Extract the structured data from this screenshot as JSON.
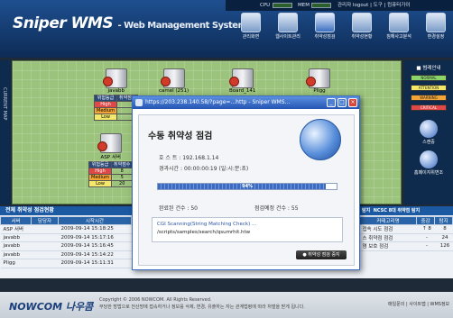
{
  "app": {
    "brand": "Sniper WMS",
    "subtitle": "- Web Management System"
  },
  "topbar": {
    "cpu": "CPU",
    "mem": "MEM",
    "user": "관리자 logout | 도구 | 컴퓨터가이"
  },
  "nav": [
    {
      "label": "관리화면",
      "icon": "monitor-icon"
    },
    {
      "label": "웹사이트관리",
      "icon": "web-icon"
    },
    {
      "label": "취약성점검",
      "icon": "scan-icon"
    },
    {
      "label": "취약성현황",
      "icon": "status-icon"
    },
    {
      "label": "침해사고분석",
      "icon": "incident-icon"
    },
    {
      "label": "환경설정",
      "icon": "settings-icon"
    }
  ],
  "breadcrumb": "관리화면",
  "leftstrip": "CURRENT MAP",
  "map_nodes": [
    {
      "name": "javabb",
      "risk": {
        "header": [
          "위험등급",
          "취약점수"
        ],
        "rows": [
          [
            "High",
            ""
          ],
          [
            "Medium",
            ""
          ],
          [
            "Low",
            ""
          ]
        ]
      }
    },
    {
      "name": "camel (251)"
    },
    {
      "name": "Board_141"
    },
    {
      "name": "Pligg"
    },
    {
      "name": "ASP 서버",
      "risk": {
        "header": [
          "위험등급",
          "취약점수"
        ],
        "rows": [
          [
            "High",
            "8"
          ],
          [
            "Medium",
            "5"
          ],
          [
            "Low",
            "20"
          ]
        ]
      }
    }
  ],
  "legend": {
    "title": "■ 범례안내",
    "items": [
      "NORMAL",
      "ATTENTION",
      "WARNING",
      "CRITICAL"
    ]
  },
  "side": {
    "scan": "스캔중",
    "homepage": "홈페이지위변조"
  },
  "history": {
    "title": "전체 취약성 점검현황",
    "headers": [
      "서버",
      "담당자",
      "시작시간"
    ],
    "rows": [
      [
        "ASP 서버",
        "",
        "2009-09-14 15:18:25"
      ],
      [
        "javabb",
        "",
        "2009-09-14 15:17:16"
      ],
      [
        "javabb",
        "",
        "2009-09-14 15:16:45"
      ],
      [
        "javabb",
        "",
        "2009-09-14 15:14:22"
      ],
      [
        "Pligg",
        "",
        "2009-09-14 15:11:31"
      ]
    ]
  },
  "ncsc": {
    "tabs": [
      "탐지",
      "NCSC 8대 취약점",
      "탐지"
    ],
    "headers": [
      "커테고리명",
      "중감",
      "탐지"
    ],
    "rows": [
      [
        "접속 시도 점검",
        "↑ 8",
        "8"
      ],
      [
        "스 취약점 점검",
        "-",
        "24"
      ],
      [
        "염 보호 점검",
        "-",
        "126"
      ]
    ]
  },
  "footer": {
    "logo": "NOWCOM 나우콤",
    "copy": "Copyright © 2006 NOWCOM. All Rights Reserved.",
    "copy2": "부당한 방법으로 전산망에 접속하거나 정보를 삭제, 변경, 유출하는 자는 관계법령에 따라 처벌을 받게 됩니다.",
    "links": "매일문의 | 사이트맵 | WMS정보"
  },
  "dialog": {
    "window_title": "https://203.238.140.58/?page=...http - Sniper WMS...",
    "title": "수동 취약성 점검",
    "host_label": "호 스 트 :",
    "host": "192.168.1.14",
    "elapsed_label": "경과시간 :",
    "elapsed": "00:00:00:19 (일:시:분:초)",
    "progress_text": "94%",
    "progress": 0.94,
    "done_label": "완료된 건수 :",
    "done": "50",
    "planned_label": "점검예정 건수 :",
    "planned": "55",
    "log1": "CGI Scanning(String Matching Check) ...",
    "log2": "/scripts/samples/search/qsumrhit.htw",
    "stop": "취약성 점검 중지"
  }
}
